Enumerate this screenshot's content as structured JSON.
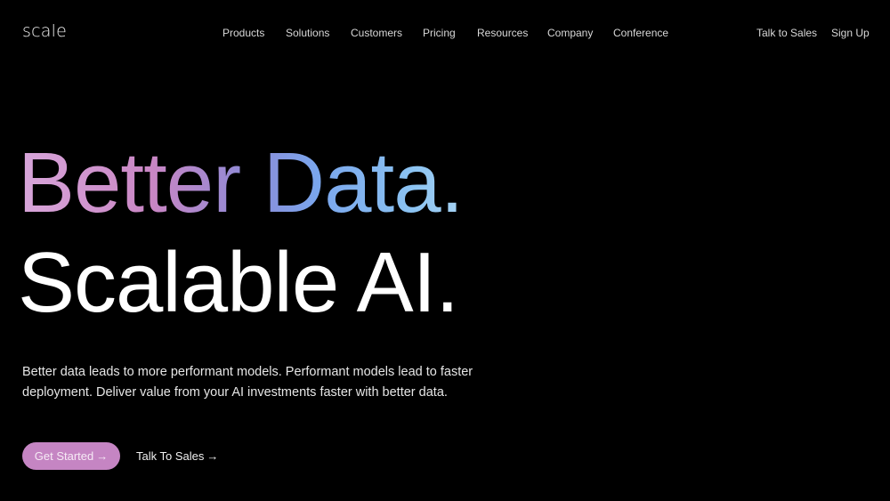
{
  "header": {
    "logo": "scale",
    "nav_items": [
      {
        "label": "Products"
      },
      {
        "label": "Solutions"
      },
      {
        "label": "Customers"
      },
      {
        "label": "Pricing"
      },
      {
        "label": "Resources"
      },
      {
        "label": "Company"
      },
      {
        "label": "Conference"
      }
    ],
    "right_links": [
      {
        "label": "Talk to Sales"
      },
      {
        "label": "Sign Up"
      }
    ]
  },
  "hero": {
    "headline_line1": "Better Data.",
    "headline_line2": "Scalable AI.",
    "gradient_colors": [
      "#d8a6da",
      "#c986c4",
      "#8d8ad6",
      "#7aa5ec",
      "#8bc3f2",
      "#b9def5"
    ],
    "subtext": "Better data leads to more performant models. Performant models lead to faster deployment. Deliver value from your AI investments faster with better data.",
    "primary_cta": {
      "label": "Get Started",
      "icon": "arrow-right-icon",
      "glyph": "→",
      "color": "#c585c3"
    },
    "secondary_cta": {
      "label": "Talk To Sales",
      "icon": "arrow-right-icon",
      "glyph": "→"
    }
  }
}
